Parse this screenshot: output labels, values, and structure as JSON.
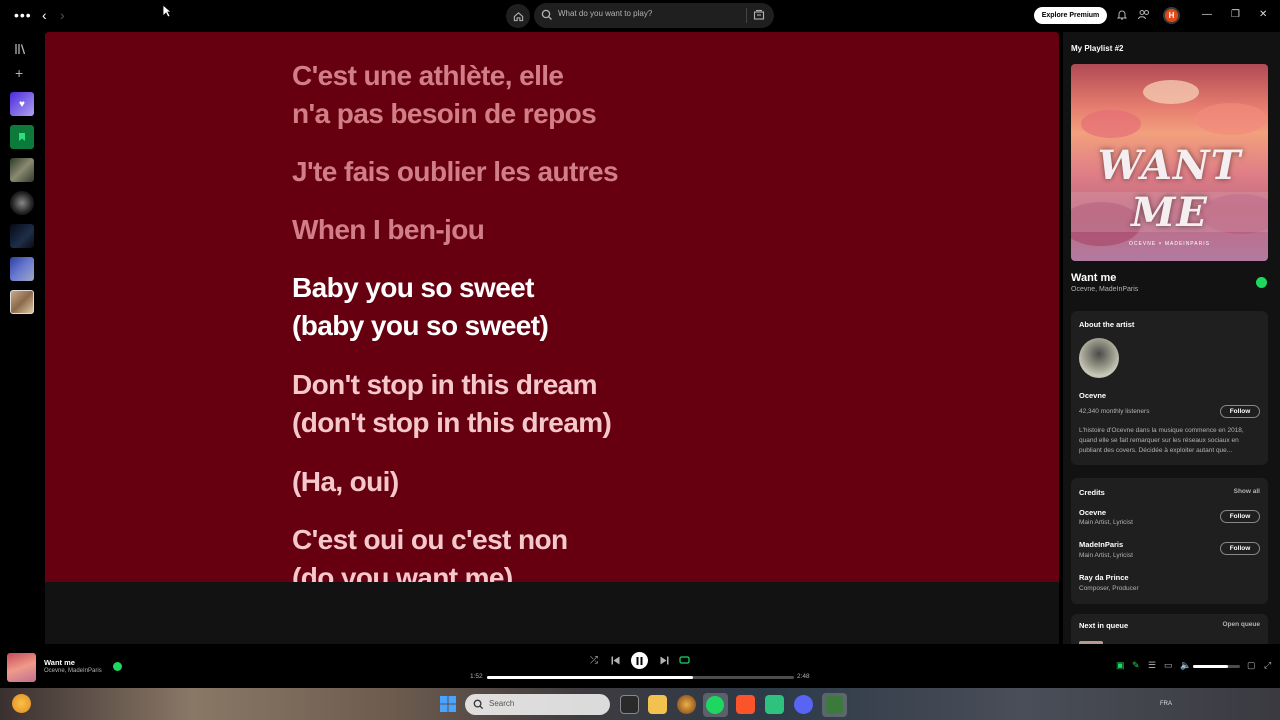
{
  "topbar": {
    "search_placeholder": "What do you want to play?",
    "premium_label": "Explore Premium",
    "avatar_initial": "H"
  },
  "lyrics": [
    {
      "text": "C'est une athlète, elle",
      "state": "past"
    },
    {
      "text": "n'a pas besoin de repos",
      "state": "past"
    },
    {
      "text": "J'te fais oublier les autres",
      "state": "past"
    },
    {
      "text": "When I ben-jou",
      "state": "past"
    },
    {
      "text": "Baby you so sweet",
      "state": "active"
    },
    {
      "text": "(baby you so sweet)",
      "state": "active"
    },
    {
      "text": "Don't stop in this dream",
      "state": "future"
    },
    {
      "text": "(don't stop in this dream)",
      "state": "future"
    },
    {
      "text": "(Ha, oui)",
      "state": "future"
    },
    {
      "text": "C'est oui ou c'est non",
      "state": "future"
    },
    {
      "text": "(do you want me)",
      "state": "future"
    }
  ],
  "right_panel": {
    "playlist_title": "My Playlist #2",
    "cover_title": "WANT ME",
    "cover_credit": "OCEVNE × MADEINPARIS",
    "song_title": "Want me",
    "song_artists": "Ocevne, MadeInParis",
    "about": {
      "heading": "About the artist",
      "artist_name": "Ocevne",
      "listeners": "42,340 monthly listeners",
      "follow_label": "Follow",
      "bio": "L'histoire d'Ocevne dans la musique commence en 2018, quand elle se fait remarquer sur les réseaux sociaux en publiant des covers. Décidée à exploiter autant que..."
    },
    "credits": {
      "heading": "Credits",
      "show_all": "Show all",
      "entries": [
        {
          "name": "Ocevne",
          "role": "Main Artist, Lyricist",
          "follow": "Follow"
        },
        {
          "name": "MadeInParis",
          "role": "Main Artist, Lyricist",
          "follow": "Follow"
        },
        {
          "name": "Ray da Prince",
          "role": "Composer, Producer",
          "follow": ""
        }
      ]
    },
    "queue": {
      "heading": "Next in queue",
      "open_label": "Open queue"
    }
  },
  "player": {
    "title": "Want me",
    "artists": "Ocevne, MadeInParis",
    "elapsed": "1:52",
    "duration": "2:48",
    "progress_fraction": 0.67,
    "volume_fraction": 0.75
  },
  "taskbar": {
    "search_placeholder": "Search",
    "lang": "FRA"
  },
  "colors": {
    "lyrics_bg": "#660010",
    "accent": "#1ed760"
  }
}
